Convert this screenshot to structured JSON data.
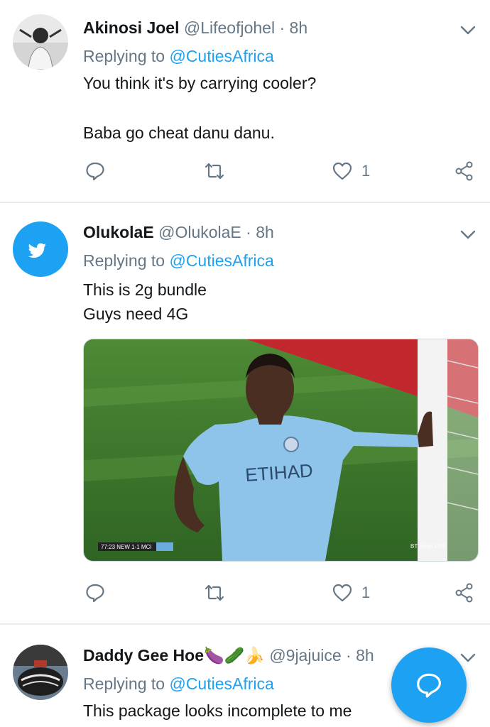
{
  "tweets": [
    {
      "name": "Akinosi Joel",
      "handle": "@Lifeofjohel",
      "dot": "·",
      "time": "8h",
      "replying_prefix": "Replying to ",
      "replying_to": "@CutiesAfrica",
      "lines": [
        "You think it's by carrying cooler?",
        "",
        "Baba go cheat danu danu."
      ],
      "like_count": "1"
    },
    {
      "name": "OlukolaE",
      "handle": "@OlukolaE",
      "dot": "·",
      "time": "8h",
      "replying_prefix": "Replying to ",
      "replying_to": "@CutiesAfrica",
      "lines": [
        "This is 2g bundle",
        "Guys need 4G"
      ],
      "like_count": "1",
      "media": {
        "scoreboard": "77:23  NEW  1-1  MCI",
        "sponsor": "ETIHAD",
        "broadcaster": "BT Sport LIVE"
      }
    },
    {
      "name": "Daddy Gee Hoe",
      "emoji": "🍆🥒🍌",
      "handle": "@9jajuice",
      "dot": "·",
      "time": "8h",
      "replying_prefix": "Replying to ",
      "replying_to": "@CutiesAfrica",
      "lines": [
        "This package looks incomplete to me"
      ]
    }
  ],
  "icons": {
    "reply": "reply-icon",
    "retweet": "retweet-icon",
    "like": "heart-icon",
    "share": "share-icon",
    "more": "chevron-down-icon",
    "compose": "compose-reply-icon"
  },
  "colors": {
    "accent": "#1da1f2",
    "text": "#14171a",
    "secondary": "#657786",
    "divider": "#e6ecf0",
    "pitch": "#3f7a2e",
    "kit": "#8ec3ea"
  }
}
